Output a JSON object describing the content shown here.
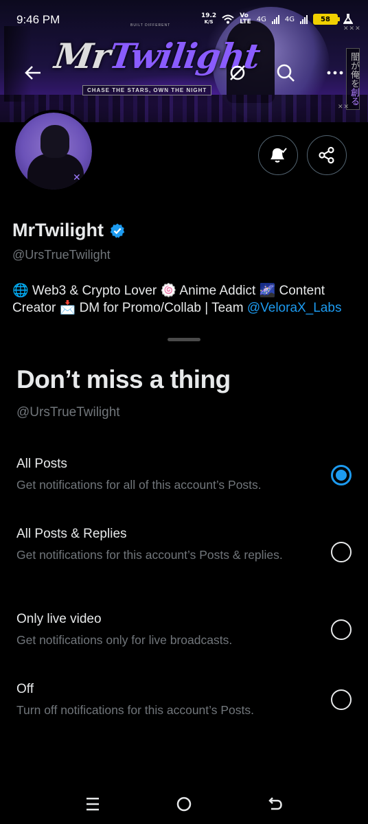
{
  "status_bar": {
    "time": "9:46 PM",
    "net_speed_value": "19.2",
    "net_speed_unit": "K/S",
    "volte_top": "Vo",
    "volte_bottom": "LTE",
    "network_1": "4G",
    "network_2": "4G",
    "battery_level": "58"
  },
  "banner": {
    "logo_a": "Mr",
    "logo_b": "Twilight",
    "tagline": "CHASE THE STARS, OWN THE NIGHT",
    "small_text": "BUILT DIFFERENT",
    "side_text_a": "闇が俺を",
    "side_text_b": "創る"
  },
  "profile": {
    "name": "MrTwilight",
    "handle": "@UrsTrueTwilight",
    "bio_text": "🌐 Web3 & Crypto Lover 🍥 Anime Addict 🌌 Content Creator 📩 DM for Promo/Collab | Team ",
    "bio_link": "@VeloraX_Labs",
    "verified": true
  },
  "sheet": {
    "title": "Don’t miss a thing",
    "handle": "@UrsTrueTwilight",
    "options": [
      {
        "title": "All Posts",
        "desc": "Get notifications for all of this account’s Posts.",
        "selected": true
      },
      {
        "title": "All Posts & Replies",
        "desc": "Get notifications for this account’s Posts & replies.",
        "selected": false
      },
      {
        "title": "Only live video",
        "desc": "Get notifications only for live broadcasts.",
        "selected": false
      },
      {
        "title": "Off",
        "desc": "Turn off notifications for this account’s Posts.",
        "selected": false
      }
    ]
  },
  "colors": {
    "accent": "#1d9bf0",
    "background": "#000000",
    "primary_text": "#e7e9ea",
    "secondary_text": "#71767b",
    "battery": "#f0d000"
  },
  "icons": {
    "back": "arrow-left-icon",
    "grok": "grok-icon",
    "search": "search-icon",
    "more": "more-horizontal-icon",
    "notify": "bell-check-icon",
    "share": "share-icon",
    "verified": "verified-badge-icon",
    "nav_menu": "menu-icon",
    "nav_home": "home-circle-icon",
    "nav_back": "back-icon"
  }
}
